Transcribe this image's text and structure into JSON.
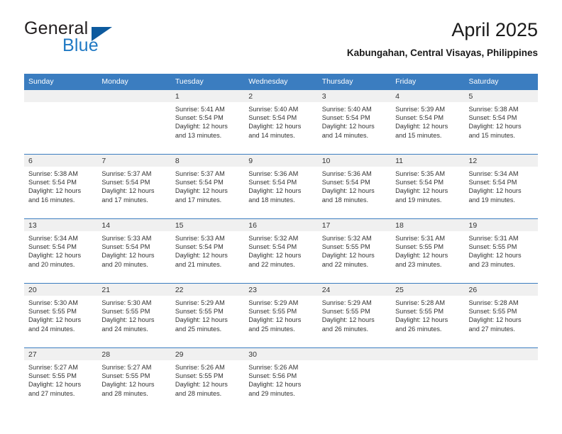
{
  "logo": {
    "word_top": "General",
    "word_bottom": "Blue",
    "triangle_color": "#0d5a9e",
    "blue_color": "#2079c4"
  },
  "header": {
    "title": "April 2025",
    "subtitle": "Kabungahan, Central Visayas, Philippines"
  },
  "theme": {
    "header_band": "#3b7dc0",
    "day_band": "#f0f0f0",
    "divider": "#3b7dc0",
    "text": "#333333"
  },
  "weekday_headers": [
    "Sunday",
    "Monday",
    "Tuesday",
    "Wednesday",
    "Thursday",
    "Friday",
    "Saturday"
  ],
  "weeks": [
    [
      {
        "day": "",
        "sunrise": "",
        "sunset": "",
        "daylight_1": "",
        "daylight_2": ""
      },
      {
        "day": "",
        "sunrise": "",
        "sunset": "",
        "daylight_1": "",
        "daylight_2": ""
      },
      {
        "day": "1",
        "sunrise": "Sunrise: 5:41 AM",
        "sunset": "Sunset: 5:54 PM",
        "daylight_1": "Daylight: 12 hours",
        "daylight_2": "and 13 minutes."
      },
      {
        "day": "2",
        "sunrise": "Sunrise: 5:40 AM",
        "sunset": "Sunset: 5:54 PM",
        "daylight_1": "Daylight: 12 hours",
        "daylight_2": "and 14 minutes."
      },
      {
        "day": "3",
        "sunrise": "Sunrise: 5:40 AM",
        "sunset": "Sunset: 5:54 PM",
        "daylight_1": "Daylight: 12 hours",
        "daylight_2": "and 14 minutes."
      },
      {
        "day": "4",
        "sunrise": "Sunrise: 5:39 AM",
        "sunset": "Sunset: 5:54 PM",
        "daylight_1": "Daylight: 12 hours",
        "daylight_2": "and 15 minutes."
      },
      {
        "day": "5",
        "sunrise": "Sunrise: 5:38 AM",
        "sunset": "Sunset: 5:54 PM",
        "daylight_1": "Daylight: 12 hours",
        "daylight_2": "and 15 minutes."
      }
    ],
    [
      {
        "day": "6",
        "sunrise": "Sunrise: 5:38 AM",
        "sunset": "Sunset: 5:54 PM",
        "daylight_1": "Daylight: 12 hours",
        "daylight_2": "and 16 minutes."
      },
      {
        "day": "7",
        "sunrise": "Sunrise: 5:37 AM",
        "sunset": "Sunset: 5:54 PM",
        "daylight_1": "Daylight: 12 hours",
        "daylight_2": "and 17 minutes."
      },
      {
        "day": "8",
        "sunrise": "Sunrise: 5:37 AM",
        "sunset": "Sunset: 5:54 PM",
        "daylight_1": "Daylight: 12 hours",
        "daylight_2": "and 17 minutes."
      },
      {
        "day": "9",
        "sunrise": "Sunrise: 5:36 AM",
        "sunset": "Sunset: 5:54 PM",
        "daylight_1": "Daylight: 12 hours",
        "daylight_2": "and 18 minutes."
      },
      {
        "day": "10",
        "sunrise": "Sunrise: 5:36 AM",
        "sunset": "Sunset: 5:54 PM",
        "daylight_1": "Daylight: 12 hours",
        "daylight_2": "and 18 minutes."
      },
      {
        "day": "11",
        "sunrise": "Sunrise: 5:35 AM",
        "sunset": "Sunset: 5:54 PM",
        "daylight_1": "Daylight: 12 hours",
        "daylight_2": "and 19 minutes."
      },
      {
        "day": "12",
        "sunrise": "Sunrise: 5:34 AM",
        "sunset": "Sunset: 5:54 PM",
        "daylight_1": "Daylight: 12 hours",
        "daylight_2": "and 19 minutes."
      }
    ],
    [
      {
        "day": "13",
        "sunrise": "Sunrise: 5:34 AM",
        "sunset": "Sunset: 5:54 PM",
        "daylight_1": "Daylight: 12 hours",
        "daylight_2": "and 20 minutes."
      },
      {
        "day": "14",
        "sunrise": "Sunrise: 5:33 AM",
        "sunset": "Sunset: 5:54 PM",
        "daylight_1": "Daylight: 12 hours",
        "daylight_2": "and 20 minutes."
      },
      {
        "day": "15",
        "sunrise": "Sunrise: 5:33 AM",
        "sunset": "Sunset: 5:54 PM",
        "daylight_1": "Daylight: 12 hours",
        "daylight_2": "and 21 minutes."
      },
      {
        "day": "16",
        "sunrise": "Sunrise: 5:32 AM",
        "sunset": "Sunset: 5:54 PM",
        "daylight_1": "Daylight: 12 hours",
        "daylight_2": "and 22 minutes."
      },
      {
        "day": "17",
        "sunrise": "Sunrise: 5:32 AM",
        "sunset": "Sunset: 5:55 PM",
        "daylight_1": "Daylight: 12 hours",
        "daylight_2": "and 22 minutes."
      },
      {
        "day": "18",
        "sunrise": "Sunrise: 5:31 AM",
        "sunset": "Sunset: 5:55 PM",
        "daylight_1": "Daylight: 12 hours",
        "daylight_2": "and 23 minutes."
      },
      {
        "day": "19",
        "sunrise": "Sunrise: 5:31 AM",
        "sunset": "Sunset: 5:55 PM",
        "daylight_1": "Daylight: 12 hours",
        "daylight_2": "and 23 minutes."
      }
    ],
    [
      {
        "day": "20",
        "sunrise": "Sunrise: 5:30 AM",
        "sunset": "Sunset: 5:55 PM",
        "daylight_1": "Daylight: 12 hours",
        "daylight_2": "and 24 minutes."
      },
      {
        "day": "21",
        "sunrise": "Sunrise: 5:30 AM",
        "sunset": "Sunset: 5:55 PM",
        "daylight_1": "Daylight: 12 hours",
        "daylight_2": "and 24 minutes."
      },
      {
        "day": "22",
        "sunrise": "Sunrise: 5:29 AM",
        "sunset": "Sunset: 5:55 PM",
        "daylight_1": "Daylight: 12 hours",
        "daylight_2": "and 25 minutes."
      },
      {
        "day": "23",
        "sunrise": "Sunrise: 5:29 AM",
        "sunset": "Sunset: 5:55 PM",
        "daylight_1": "Daylight: 12 hours",
        "daylight_2": "and 25 minutes."
      },
      {
        "day": "24",
        "sunrise": "Sunrise: 5:29 AM",
        "sunset": "Sunset: 5:55 PM",
        "daylight_1": "Daylight: 12 hours",
        "daylight_2": "and 26 minutes."
      },
      {
        "day": "25",
        "sunrise": "Sunrise: 5:28 AM",
        "sunset": "Sunset: 5:55 PM",
        "daylight_1": "Daylight: 12 hours",
        "daylight_2": "and 26 minutes."
      },
      {
        "day": "26",
        "sunrise": "Sunrise: 5:28 AM",
        "sunset": "Sunset: 5:55 PM",
        "daylight_1": "Daylight: 12 hours",
        "daylight_2": "and 27 minutes."
      }
    ],
    [
      {
        "day": "27",
        "sunrise": "Sunrise: 5:27 AM",
        "sunset": "Sunset: 5:55 PM",
        "daylight_1": "Daylight: 12 hours",
        "daylight_2": "and 27 minutes."
      },
      {
        "day": "28",
        "sunrise": "Sunrise: 5:27 AM",
        "sunset": "Sunset: 5:55 PM",
        "daylight_1": "Daylight: 12 hours",
        "daylight_2": "and 28 minutes."
      },
      {
        "day": "29",
        "sunrise": "Sunrise: 5:26 AM",
        "sunset": "Sunset: 5:55 PM",
        "daylight_1": "Daylight: 12 hours",
        "daylight_2": "and 28 minutes."
      },
      {
        "day": "30",
        "sunrise": "Sunrise: 5:26 AM",
        "sunset": "Sunset: 5:56 PM",
        "daylight_1": "Daylight: 12 hours",
        "daylight_2": "and 29 minutes."
      },
      {
        "day": "",
        "sunrise": "",
        "sunset": "",
        "daylight_1": "",
        "daylight_2": ""
      },
      {
        "day": "",
        "sunrise": "",
        "sunset": "",
        "daylight_1": "",
        "daylight_2": ""
      },
      {
        "day": "",
        "sunrise": "",
        "sunset": "",
        "daylight_1": "",
        "daylight_2": ""
      }
    ]
  ]
}
